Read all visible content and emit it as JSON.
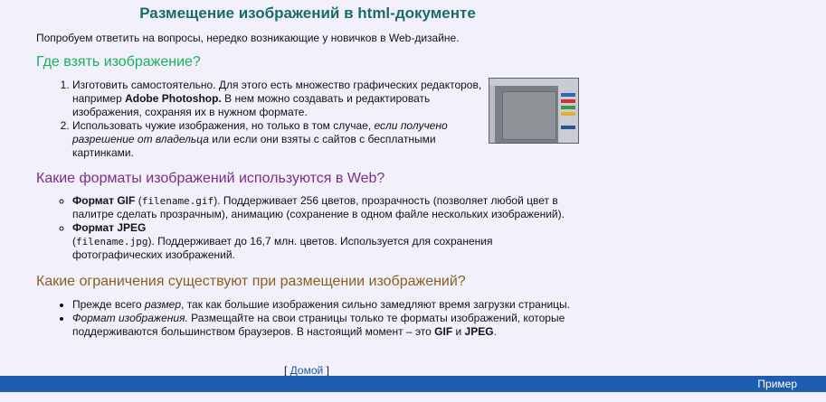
{
  "title": "Размещение изображений в html-документе",
  "intro": "Попробуем ответить на вопросы, нередко возникающие у новичков в Web-дизайне.",
  "sections": {
    "where": {
      "heading": "Где взять изображение?",
      "item1": {
        "a": "Изготовить самостоятельно. Для этого есть множество графических редакторов, например ",
        "b": "Adobe Photoshop.",
        "c": " В нем можно создавать и редактировать изображения, сохраняя их в нужном формате."
      },
      "item2": {
        "a": "Использовать чужие изображения, но только в том случае, ",
        "b": "если получено разрешение от владельца",
        "c": " или если они взяты с сайтов с бесплатными картинками."
      }
    },
    "formats": {
      "heading": "Какие форматы изображений используются в Web?",
      "gif": {
        "label": "Формат GIF",
        "pre": " (",
        "code": "filename.gif",
        "text": "). Поддерживает 256 цветов, прозрачность (позволяет любой цвет в палитре сделать прозрачным), анимацию (сохранение в одном файле нескольких изображений)."
      },
      "jpeg": {
        "label": "Формат JPEG",
        "pre": "(",
        "code": "filename.jpg",
        "text": "). Поддерживает до 16,7 млн. цветов. Используется для сохранения фотографических изображений."
      }
    },
    "limits": {
      "heading": "Какие ограничения существуют при размещении изображений?",
      "item1": {
        "a": "Прежде всего ",
        "b": "размер",
        "c": ", так как большие изображения сильно замедляют время загрузки страницы."
      },
      "item2": {
        "a": "Формат изображения.",
        "b": " Размещайте на свои страницы только те форматы изображений, которые поддерживаются большинством браузеров. В настоящий момент – это ",
        "c": "GIF",
        "d": " и ",
        "e": "JPEG",
        "f": "."
      }
    }
  },
  "home_link": {
    "open": "[ ",
    "label": "Домой",
    "close": " ]"
  },
  "bottom_bar": {
    "label": "Пример"
  },
  "image_icon": "photoshop-screenshot-thumbnail",
  "colors": {
    "background": "#f2f1fb",
    "title": "#1a6b6b",
    "heading_where": "#18b25a",
    "heading_formats": "#7d2c8c",
    "heading_limits": "#8a6020",
    "link": "#1f58a8",
    "bar": "#1d5eb0"
  }
}
